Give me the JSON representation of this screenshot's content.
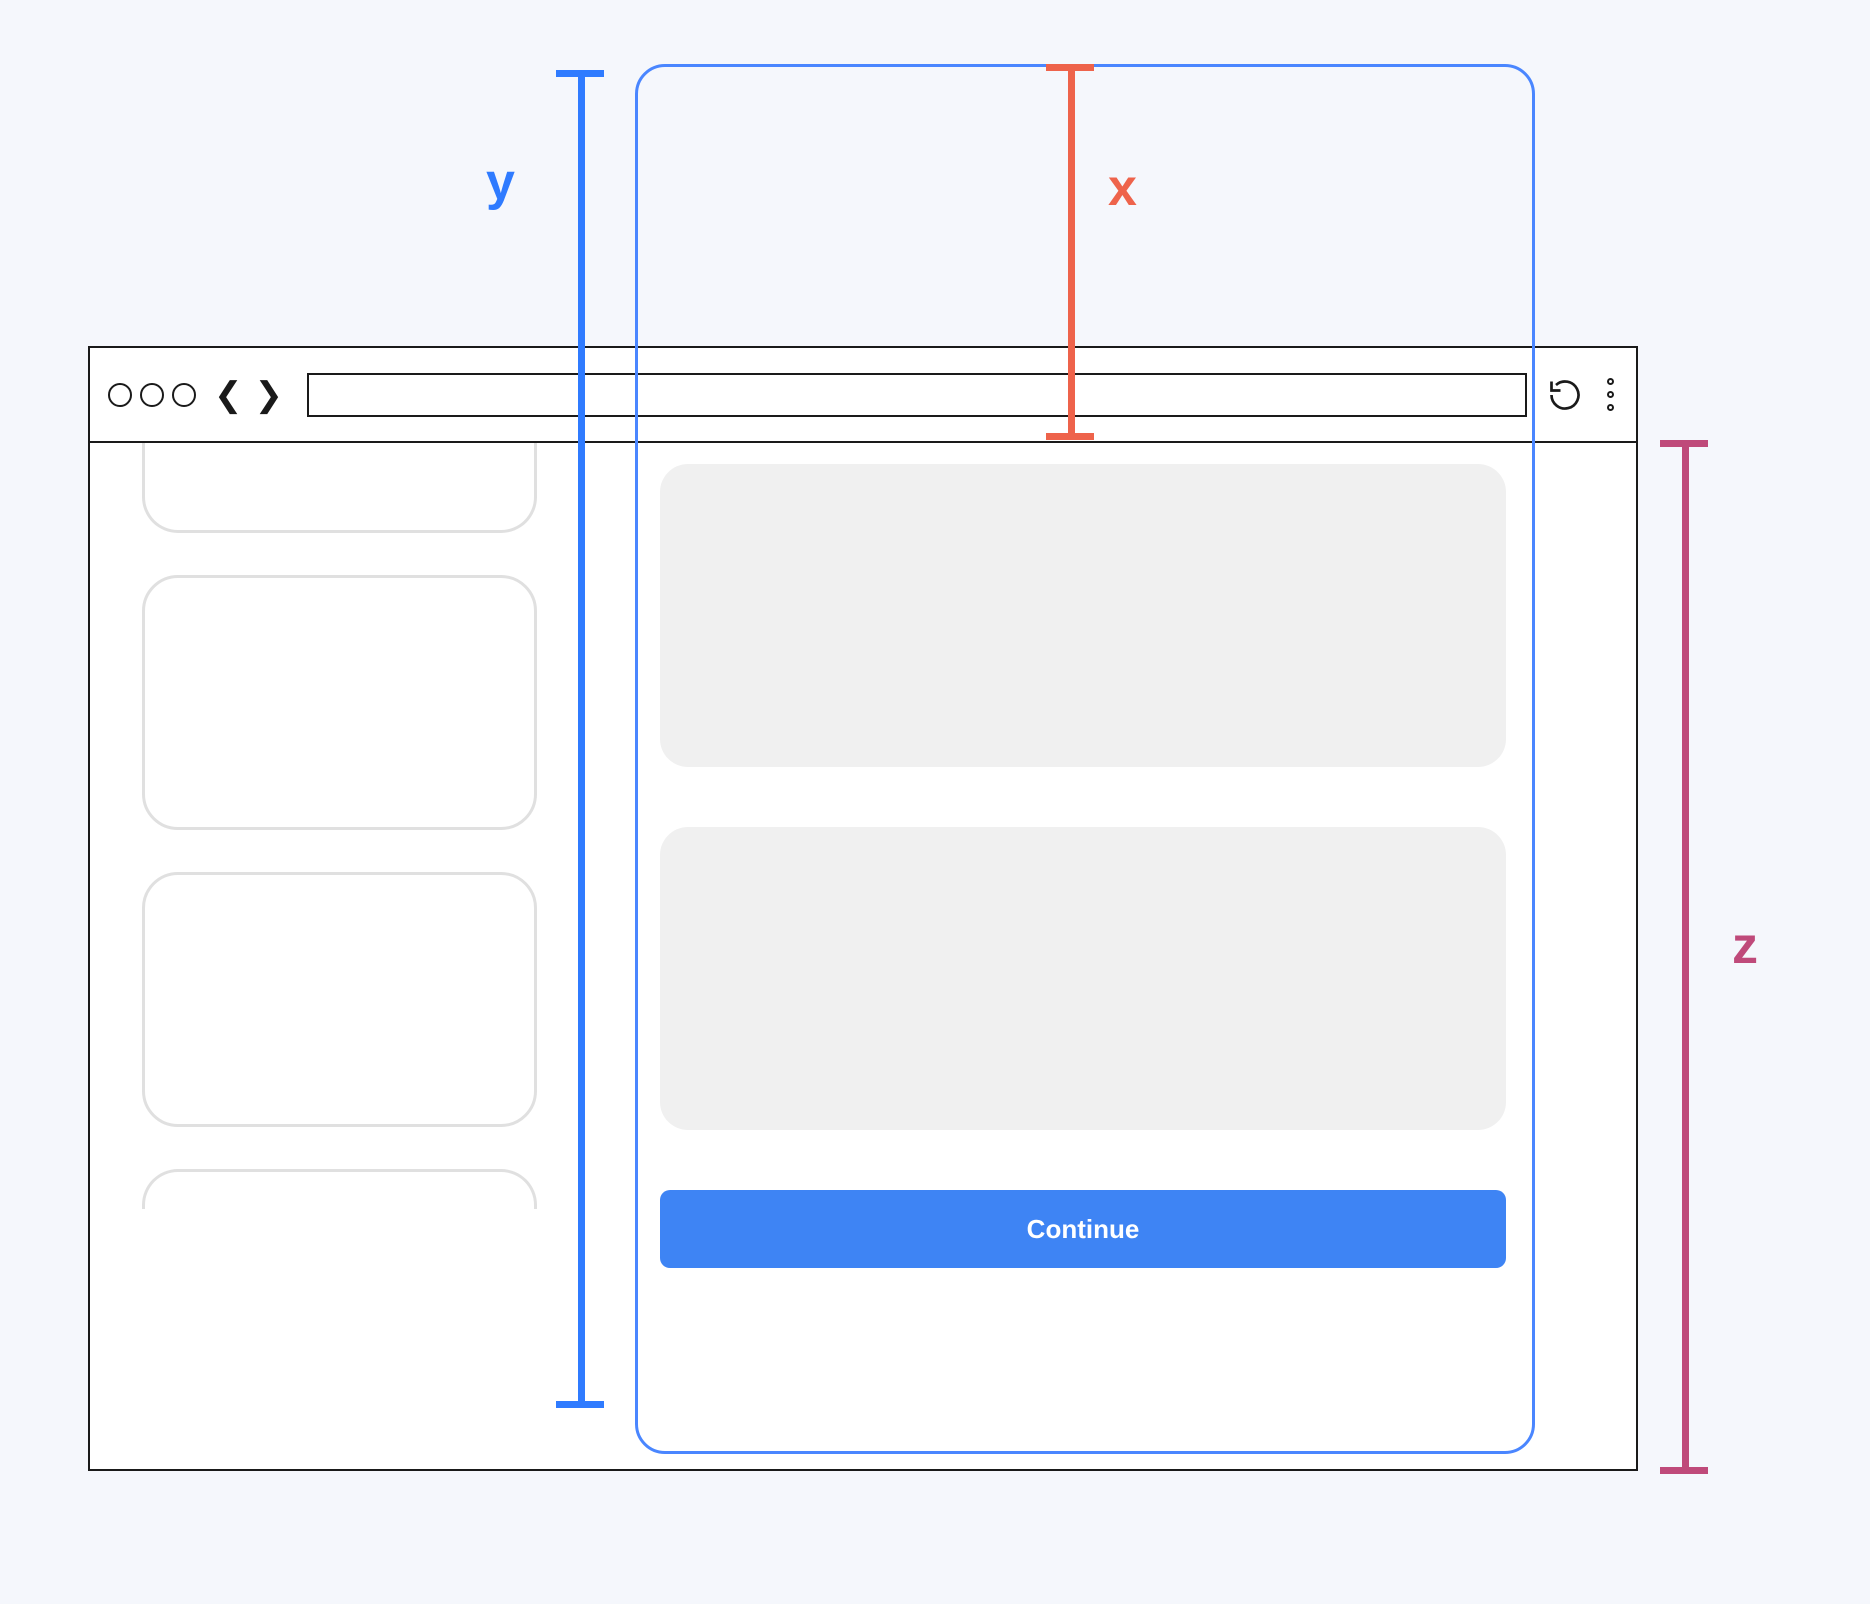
{
  "labels": {
    "y": "y",
    "x": "x",
    "z": "z"
  },
  "buttons": {
    "continue": "Continue"
  },
  "colors": {
    "y": "#2f7bff",
    "x": "#ee634b",
    "z": "#bf4a7a",
    "iframe_border": "#4a86ff",
    "primary_button": "#3e84f4"
  },
  "diagram": {
    "description": "Browser window with embedded iframe/panel; brackets indicate offsets y (panel top to content bottom), x (panel top to viewport top), and z (viewport height below toolbar)."
  }
}
